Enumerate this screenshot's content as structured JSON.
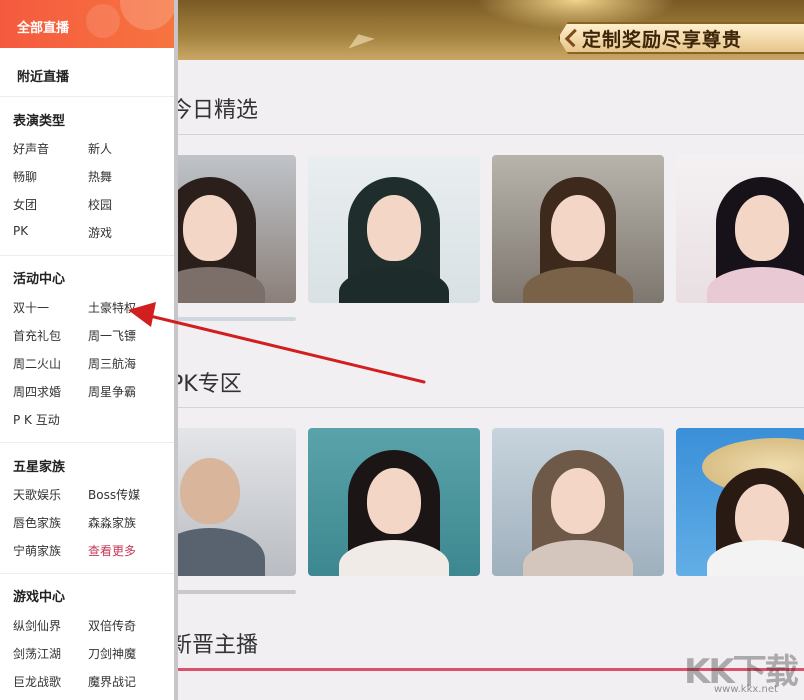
{
  "banner": {
    "slogan": "定制奖励尽享尊贵"
  },
  "sections": [
    {
      "title": "今日精选"
    },
    {
      "title": "PK专区"
    },
    {
      "title": "新晋主播"
    }
  ],
  "menu": {
    "header": "全部直播",
    "nearby": "附近直播",
    "groups": [
      {
        "title": "表演类型",
        "items": [
          "好声音",
          "新人",
          "畅聊",
          "热舞",
          "女团",
          "校园",
          "PK",
          "游戏"
        ]
      },
      {
        "title": "活动中心",
        "items": [
          "双十一",
          "土豪特权",
          "首充礼包",
          "周一飞镖",
          "周二火山",
          "周三航海",
          "周四求婚",
          "周星争霸",
          "P K 互动"
        ]
      },
      {
        "title": "五星家族",
        "items": [
          "天歌娱乐",
          "Boss传媒",
          "唇色家族",
          "森淼家族",
          "宁萌家族",
          "查看更多"
        ]
      },
      {
        "title": "游戏中心",
        "items": [
          "纵剑仙界",
          "双倍传奇",
          "剑荡江湖",
          "刀剑神魔",
          "巨龙战歌",
          "魔界战记"
        ]
      }
    ]
  },
  "colors": {
    "accent": "#f55a3f",
    "highlight_link": "#c23a58",
    "arrow": "#d11f1f"
  },
  "watermark": {
    "letters": "KK下载",
    "url": "www.kkx.net"
  }
}
